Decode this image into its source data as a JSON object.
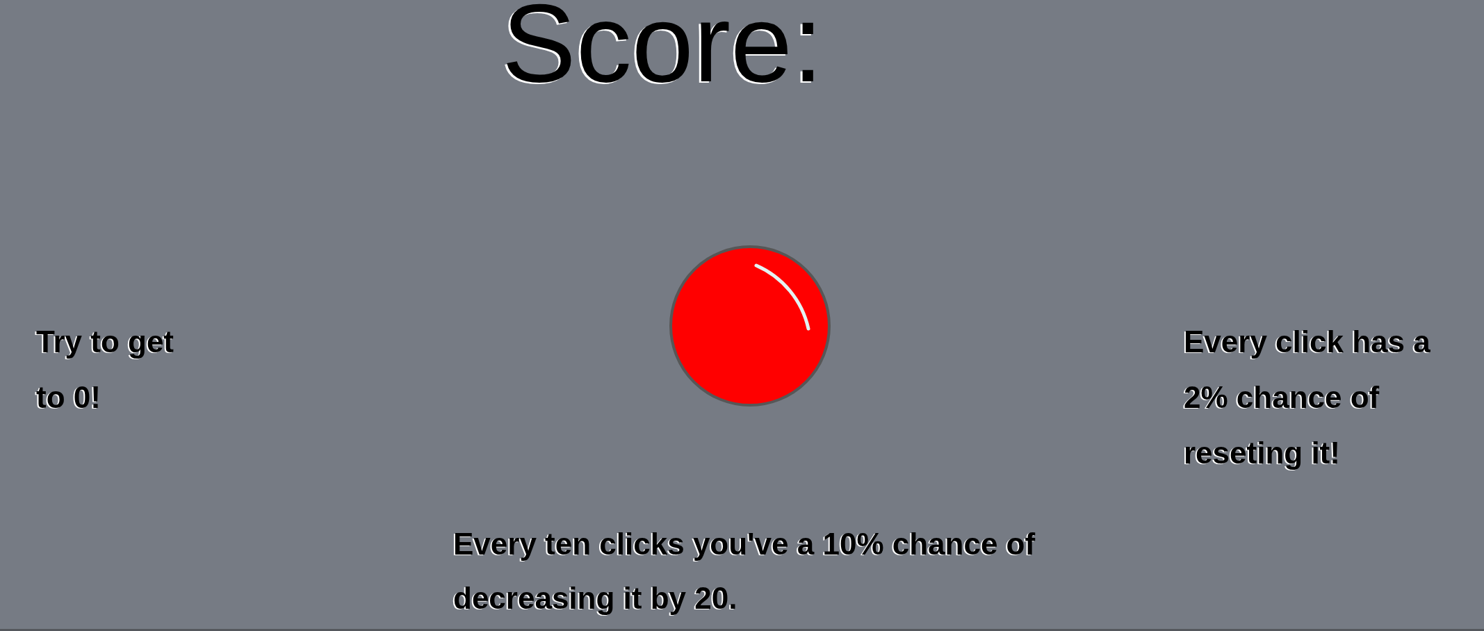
{
  "score_label": "Score:",
  "left_hint": "Try to get to 0!",
  "right_hint": "Every click has a 2% chance of reseting it!",
  "bottom_hint": "Every ten clicks you've a 10% chance of decreasing it by 20."
}
